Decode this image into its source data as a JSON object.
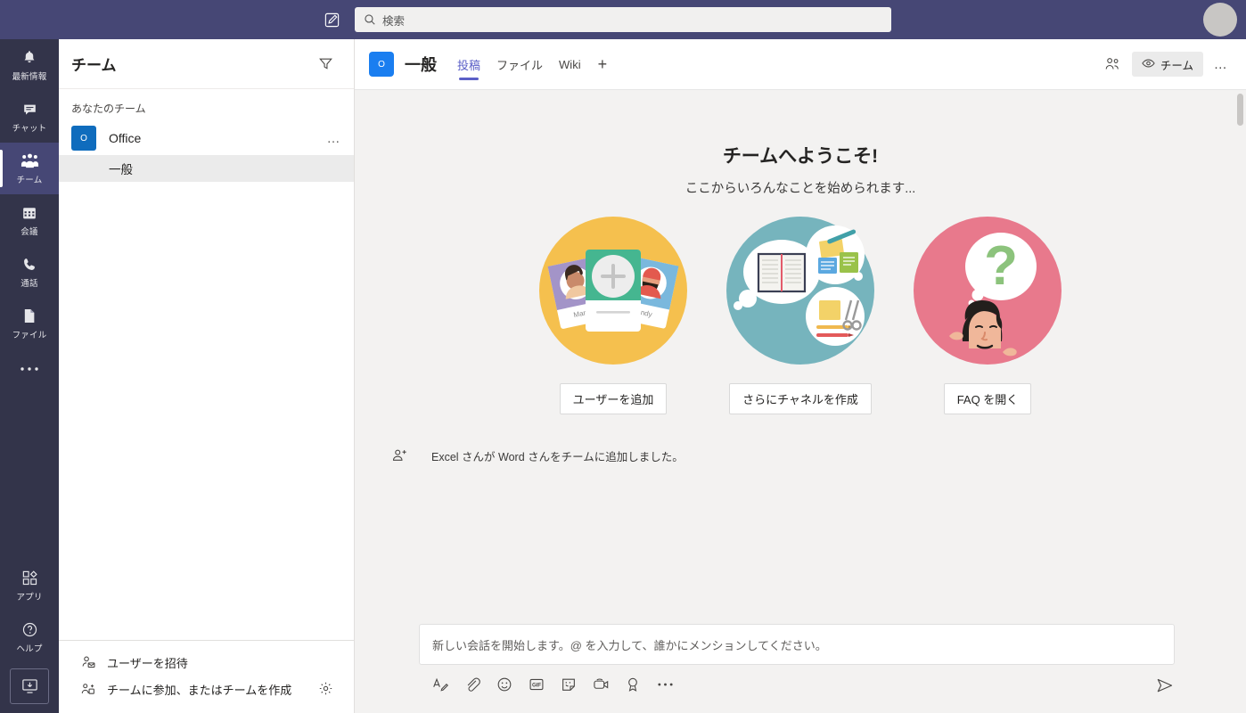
{
  "topbar": {
    "compose_icon": "compose-new-chat-icon",
    "search": {
      "placeholder": "検索",
      "value": "",
      "icon": "search-icon"
    },
    "avatar": "user-avatar"
  },
  "rail": {
    "items": [
      {
        "label": "最新情報",
        "icon": "bell-icon",
        "active": false
      },
      {
        "label": "チャット",
        "icon": "chat-bubble-icon",
        "active": false
      },
      {
        "label": "チーム",
        "icon": "teams-people-icon",
        "active": true
      },
      {
        "label": "会議",
        "icon": "calendar-icon",
        "active": false
      },
      {
        "label": "通話",
        "icon": "phone-icon",
        "active": false
      },
      {
        "label": "ファイル",
        "icon": "file-icon",
        "active": false
      }
    ],
    "more_label": "…",
    "bottom": [
      {
        "label": "アプリ",
        "icon": "apps-grid-icon"
      },
      {
        "label": "ヘルプ",
        "icon": "help-question-icon"
      }
    ],
    "download_icon": "download-desktop-app-icon"
  },
  "sidebar": {
    "title": "チーム",
    "filter_icon": "filter-funnel-icon",
    "group_label": "あなたのチーム",
    "teams": [
      {
        "name": "Office",
        "avatar_initial": "O",
        "avatar_color": "#0f6cbd",
        "more_label": "…",
        "channels": [
          {
            "name": "一般",
            "selected": true
          }
        ]
      }
    ],
    "footer": {
      "invite_label": "ユーザーを招待",
      "invite_icon": "invite-person-icon",
      "join_label": "チームに参加、またはチームを作成",
      "join_icon": "add-team-icon",
      "settings_icon": "gear-icon"
    }
  },
  "channel": {
    "avatar_initial": "O",
    "avatar_color": "#1a7ef0",
    "name": "一般",
    "tabs": [
      {
        "label": "投稿",
        "active": true
      },
      {
        "label": "ファイル",
        "active": false
      },
      {
        "label": "Wiki",
        "active": false
      }
    ],
    "add_tab_label": "+",
    "members_icon": "members-people-icon",
    "team_pill": {
      "label": "チーム",
      "icon": "eye-icon"
    },
    "more_label": "…"
  },
  "welcome": {
    "title": "チームへようこそ!",
    "subtitle": "ここからいろんなことを始められます...",
    "cards": [
      {
        "button": "ユーザーを追加",
        "illustration": "add-users-illustration",
        "bg": "#f5c04e"
      },
      {
        "button": "さらにチャネルを作成",
        "illustration": "create-channels-illustration",
        "bg": "#76b4bd"
      },
      {
        "button": "FAQ を開く",
        "illustration": "faq-illustration",
        "bg": "#e8798c"
      }
    ]
  },
  "system_message": {
    "icon": "add-member-icon",
    "actor": "Excel",
    "text_parts": [
      "Excel",
      " さんが ",
      "Word",
      " さんをチームに追加しました。"
    ],
    "full_text": "Excel さんが Word さんをチームに追加しました。"
  },
  "compose": {
    "placeholder": "新しい会話を開始します。@ を入力して、誰かにメンションしてください。",
    "value": "",
    "tools": [
      {
        "name": "format-text-icon"
      },
      {
        "name": "attach-file-icon"
      },
      {
        "name": "emoji-icon"
      },
      {
        "name": "giphy-icon"
      },
      {
        "name": "sticker-icon"
      },
      {
        "name": "meet-now-video-icon"
      },
      {
        "name": "praise-award-icon"
      },
      {
        "name": "more-options-icon"
      }
    ],
    "send_icon": "send-paper-plane-icon"
  },
  "colors": {
    "brand_purple": "#464775",
    "rail_dark": "#33344a",
    "accent_purple": "#5b5fc7",
    "canvas": "#f3f2f1"
  }
}
